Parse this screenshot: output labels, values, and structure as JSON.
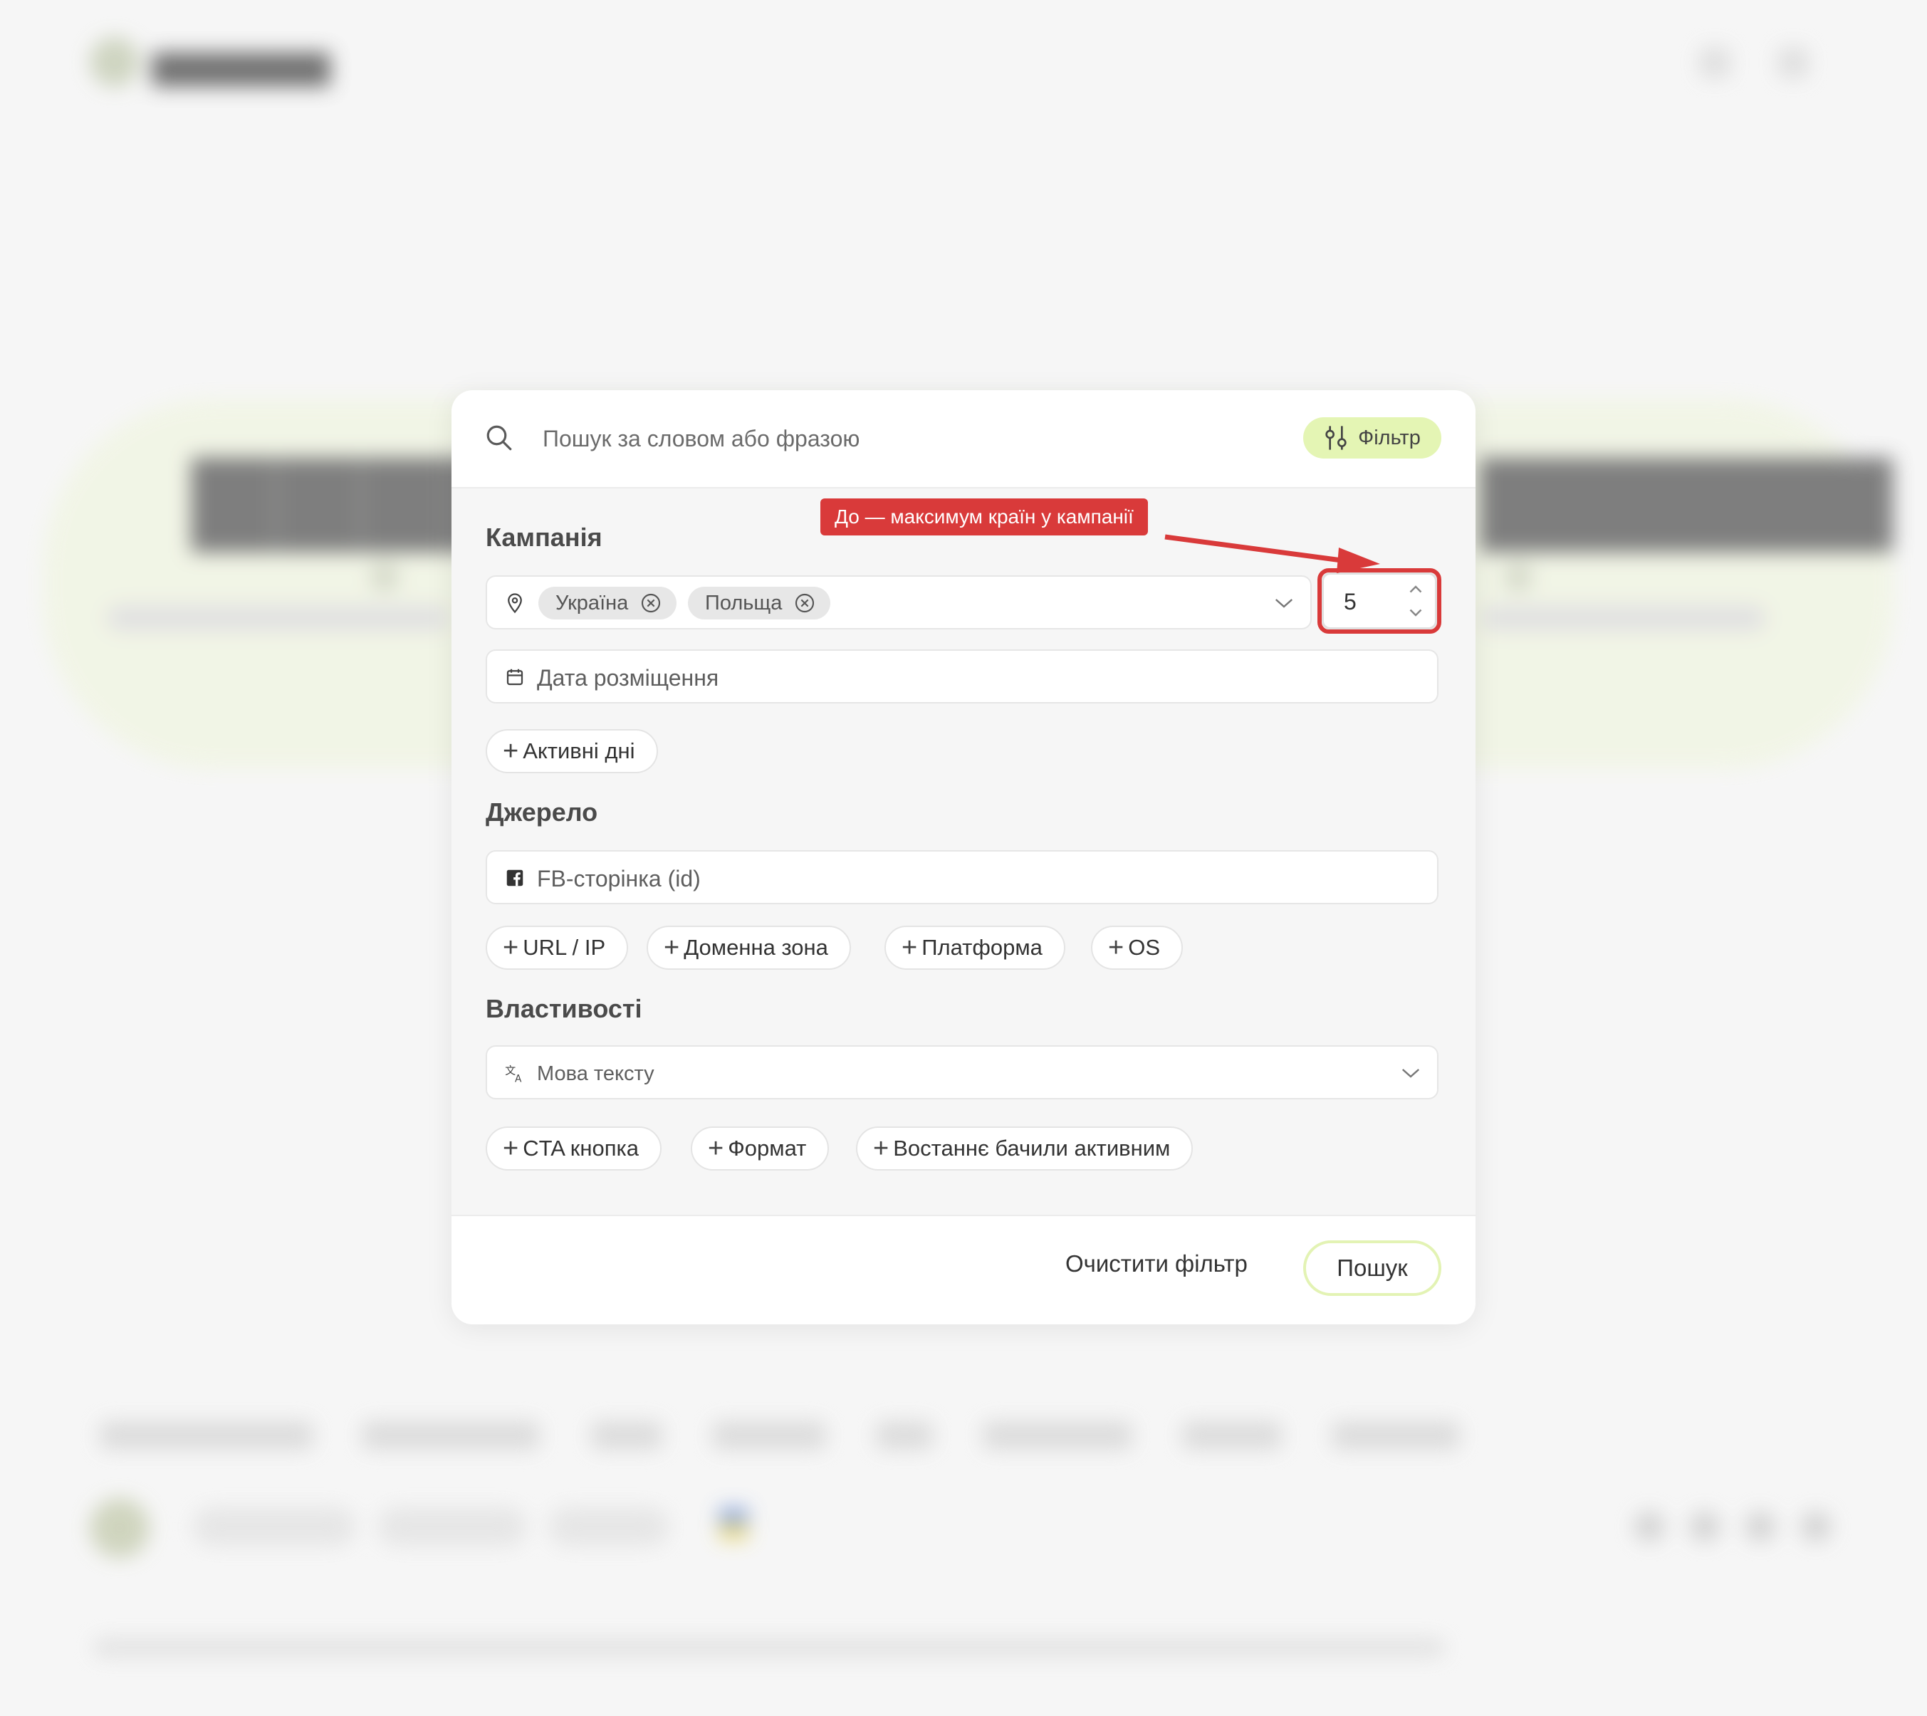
{
  "search": {
    "placeholder": "Пошук за словом або фразою"
  },
  "filter_button": {
    "label": "Фільтр"
  },
  "campaign": {
    "title": "Кампанія",
    "countries": [
      "Україна",
      "Польща"
    ],
    "max_countries": "5",
    "placement_date_placeholder": "Дата розміщення",
    "active_days_label": "Активні дні"
  },
  "source": {
    "title": "Джерело",
    "fb_page_placeholder": "FB-сторінка (id)",
    "chips": [
      "URL / IP",
      "Доменна зона",
      "Платформа",
      "OS"
    ]
  },
  "properties": {
    "title": "Властивості",
    "language_placeholder": "Мова тексту",
    "chips": [
      "CTA кнопка",
      "Формат",
      "Востаннє бачили активним"
    ]
  },
  "footer": {
    "clear_label": "Очистити фільтр",
    "submit_label": "Пошук"
  },
  "annotation": {
    "text": "До — максимум країн у кампанії",
    "color": "#d93a3a"
  },
  "colors": {
    "accent": "#e4f5b4",
    "highlight": "#d93a3a"
  }
}
